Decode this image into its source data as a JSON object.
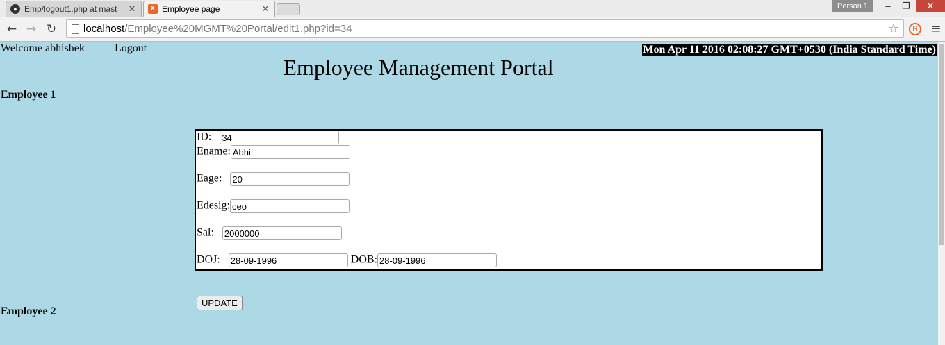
{
  "browser": {
    "tabs": [
      {
        "title": "Emp/logout1.php at mast",
        "favicon": "github-icon",
        "active": false
      },
      {
        "title": "Employee page",
        "favicon": "xampp-icon",
        "active": true
      }
    ],
    "profile": "Person 1",
    "address": {
      "host": "localhost",
      "path": "/Employee%20MGMT%20Portal/edit1.php?id=34"
    }
  },
  "page": {
    "welcome": "Welcome abhishek",
    "logout": "Logout",
    "clock": "Mon Apr 11 2016 02:08:27 GMT+0530 (India Standard Time)",
    "title": "Employee Management Portal",
    "section1": "Employee 1",
    "section2": "Employee 2",
    "form": {
      "id_label": "ID:",
      "id_value": "34",
      "ename_label": "Ename:",
      "ename_value": "Abhi",
      "eage_label": "Eage:",
      "eage_value": "20",
      "edesig_label": "Edesig:",
      "edesig_value": "ceo",
      "sal_label": "Sal:",
      "sal_value": "2000000",
      "doj_label": "DOJ:",
      "doj_value": "28-09-1996",
      "dob_label": "DOB:",
      "dob_value": "28-09-1996"
    },
    "update_label": "UPDATE"
  },
  "colors": {
    "page_bg": "#add8e6",
    "clock_bg": "#000000",
    "close_btn": "#c7463b"
  }
}
